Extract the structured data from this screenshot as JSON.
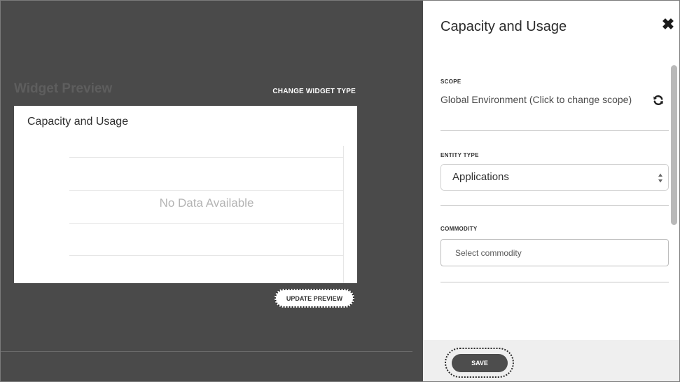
{
  "preview": {
    "title": "Widget Preview",
    "change_type_label": "CHANGE WIDGET TYPE",
    "widget_title": "Capacity and Usage",
    "empty_message": "No Data Available",
    "update_label": "UPDATE PREVIEW"
  },
  "panel": {
    "title": "Capacity and Usage",
    "close_icon": "close-icon",
    "scope": {
      "label": "SCOPE",
      "value": "Global Environment (Click to change scope)",
      "icon": "refresh-icon"
    },
    "entity_type": {
      "label": "ENTITY TYPE",
      "value": "Applications"
    },
    "commodity": {
      "label": "COMMODITY",
      "placeholder": "Select commodity"
    },
    "save_label": "SAVE"
  },
  "colors": {
    "preview_background": "#4a4a4a",
    "save_button": "#4d4d4d",
    "footer_background": "#efefef"
  }
}
